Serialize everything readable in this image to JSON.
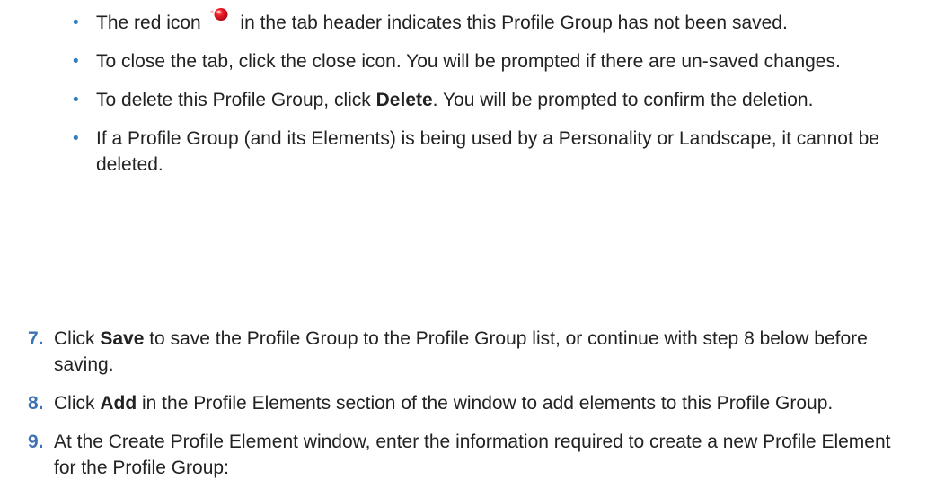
{
  "bullets": [
    {
      "before_icon": "The red icon",
      "icon": "red-unsaved-dot-icon",
      "after_icon": "in the tab header indicates this Profile Group has not been saved."
    },
    {
      "text": "To close the tab, click the close icon. You will be prompted if there are un-saved changes."
    },
    {
      "before": "To delete this Profile Group, click ",
      "bold": "Delete",
      "after": ". You will be prompted to confirm the deletion."
    },
    {
      "text": "If a Profile Group (and its Elements) is being used by a Personality or Landscape, it cannot be deleted."
    }
  ],
  "bullet_glyph": "•",
  "steps": [
    {
      "number": "7.",
      "before": "Click ",
      "bold": "Save",
      "after": " to save the Profile Group to the Profile Group list, or continue with step 8 below before saving."
    },
    {
      "number": "8.",
      "before": "Click ",
      "bold": "Add",
      "after": " in the Profile Elements section of the window to add elements to this Profile Group."
    },
    {
      "number": "9.",
      "text": "At the Create Profile Element window, enter the information required to create a new Profile Element for the Profile Group:"
    }
  ],
  "colors": {
    "text": "#222222",
    "bullet": "#2f7fc0",
    "step_number": "#3d72b0",
    "icon_red": "#d8101c"
  }
}
